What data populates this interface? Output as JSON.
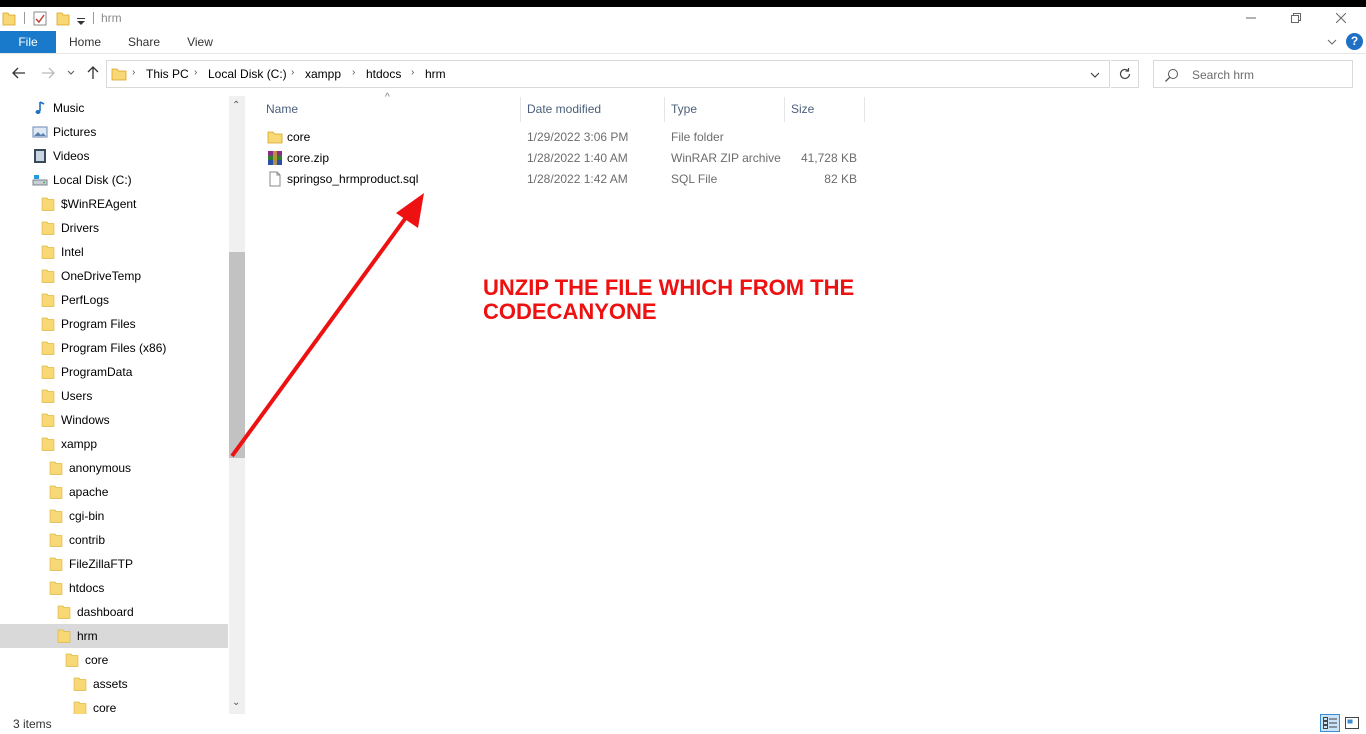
{
  "window": {
    "title": "hrm"
  },
  "ribbon": {
    "tabs": [
      "File",
      "Home",
      "Share",
      "View"
    ]
  },
  "address": {
    "crumbs": [
      "This PC",
      "Local Disk (C:)",
      "xampp",
      "htdocs",
      "hrm"
    ]
  },
  "search": {
    "placeholder": "Search hrm"
  },
  "sidebar": {
    "items": [
      {
        "label": "Music",
        "icon": "music-icon",
        "depth": 0
      },
      {
        "label": "Pictures",
        "icon": "pictures-icon",
        "depth": 0
      },
      {
        "label": "Videos",
        "icon": "videos-icon",
        "depth": 0
      },
      {
        "label": "Local Disk (C:)",
        "icon": "drive-icon",
        "depth": 0
      },
      {
        "label": "$WinREAgent",
        "icon": "folder-icon",
        "depth": 1
      },
      {
        "label": "Drivers",
        "icon": "folder-icon",
        "depth": 1
      },
      {
        "label": "Intel",
        "icon": "folder-icon",
        "depth": 1
      },
      {
        "label": "OneDriveTemp",
        "icon": "folder-icon",
        "depth": 1
      },
      {
        "label": "PerfLogs",
        "icon": "folder-icon",
        "depth": 1
      },
      {
        "label": "Program Files",
        "icon": "folder-icon",
        "depth": 1
      },
      {
        "label": "Program Files (x86)",
        "icon": "folder-icon",
        "depth": 1
      },
      {
        "label": "ProgramData",
        "icon": "folder-icon",
        "depth": 1
      },
      {
        "label": "Users",
        "icon": "folder-icon",
        "depth": 1
      },
      {
        "label": "Windows",
        "icon": "folder-icon",
        "depth": 1
      },
      {
        "label": "xampp",
        "icon": "folder-icon",
        "depth": 1
      },
      {
        "label": "anonymous",
        "icon": "folder-icon",
        "depth": 2
      },
      {
        "label": "apache",
        "icon": "folder-icon",
        "depth": 2
      },
      {
        "label": "cgi-bin",
        "icon": "folder-icon",
        "depth": 2
      },
      {
        "label": "contrib",
        "icon": "folder-icon",
        "depth": 2
      },
      {
        "label": "FileZillaFTP",
        "icon": "folder-icon",
        "depth": 2
      },
      {
        "label": "htdocs",
        "icon": "folder-icon",
        "depth": 2
      },
      {
        "label": "dashboard",
        "icon": "folder-icon",
        "depth": 3
      },
      {
        "label": "hrm",
        "icon": "folder-icon",
        "depth": 3,
        "selected": true
      },
      {
        "label": "core",
        "icon": "folder-icon",
        "depth": 4
      },
      {
        "label": "assets",
        "icon": "folder-icon",
        "depth": 5
      },
      {
        "label": "core",
        "icon": "folder-icon",
        "depth": 5
      }
    ]
  },
  "columns": {
    "name": "Name",
    "date": "Date modified",
    "type": "Type",
    "size": "Size"
  },
  "files": [
    {
      "name": "core",
      "date": "1/29/2022 3:06 PM",
      "type": "File folder",
      "size": "",
      "icon": "folder-icon"
    },
    {
      "name": "core.zip",
      "date": "1/28/2022 1:40 AM",
      "type": "WinRAR ZIP archive",
      "size": "41,728 KB",
      "icon": "winrar-icon"
    },
    {
      "name": "springso_hrmproduct.sql",
      "date": "1/28/2022 1:42 AM",
      "type": "SQL File",
      "size": "82 KB",
      "icon": "file-icon"
    }
  ],
  "annotation": {
    "line1": "UNZIP THE FILE WHICH FROM THE",
    "line2": "CODECANYONE",
    "color": "#ee1111"
  },
  "status": {
    "items_count": "3 items"
  },
  "colors": {
    "file_tab": "#1979ca",
    "selection": "#d9d9d9",
    "folder": "#f8d775"
  }
}
